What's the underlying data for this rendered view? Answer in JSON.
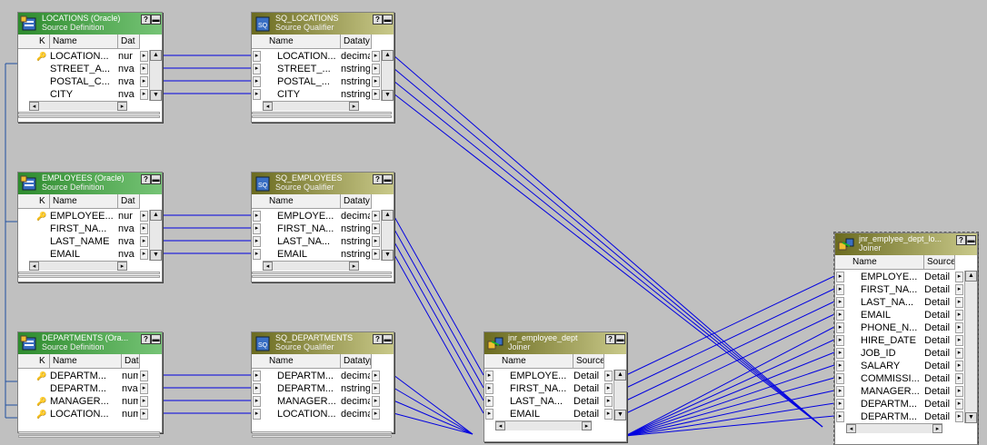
{
  "colors": {
    "link": "#0000e0",
    "source_header": "#2e8b2e",
    "qualifier_header": "#8b8b3a",
    "canvas": "#c0c0c0"
  },
  "tables": {
    "loc_src": {
      "title": "LOCATIONS (Oracle)",
      "subtitle": "Source Definition",
      "cols": [
        "K",
        "Name",
        "Dat"
      ],
      "rows": [
        {
          "key": "🔑",
          "name": "LOCATION...",
          "type": "nur"
        },
        {
          "key": "",
          "name": "STREET_A...",
          "type": "nva"
        },
        {
          "key": "",
          "name": "POSTAL_C...",
          "type": "nva"
        },
        {
          "key": "",
          "name": "CITY",
          "type": "nva"
        }
      ]
    },
    "loc_sq": {
      "title": "SQ_LOCATIONS",
      "subtitle": "Source Qualifier",
      "cols": [
        "Name",
        "Dataty"
      ],
      "rows": [
        {
          "name": "LOCATION...",
          "type": "decimal"
        },
        {
          "name": "STREET_...",
          "type": "nstring"
        },
        {
          "name": "POSTAL_...",
          "type": "nstring"
        },
        {
          "name": "CITY",
          "type": "nstring"
        }
      ]
    },
    "emp_src": {
      "title": "EMPLOYEES (Oracle)",
      "subtitle": "Source Definition",
      "cols": [
        "K",
        "Name",
        "Dat"
      ],
      "rows": [
        {
          "key": "🔑",
          "name": "EMPLOYEE...",
          "type": "nur"
        },
        {
          "key": "",
          "name": "FIRST_NA...",
          "type": "nva"
        },
        {
          "key": "",
          "name": "LAST_NAME",
          "type": "nva"
        },
        {
          "key": "",
          "name": "EMAIL",
          "type": "nva"
        }
      ]
    },
    "emp_sq": {
      "title": "SQ_EMPLOYEES",
      "subtitle": "Source Qualifier",
      "cols": [
        "Name",
        "Dataty"
      ],
      "rows": [
        {
          "name": "EMPLOYE...",
          "type": "decimal"
        },
        {
          "name": "FIRST_NA...",
          "type": "nstring"
        },
        {
          "name": "LAST_NA...",
          "type": "nstring"
        },
        {
          "name": "EMAIL",
          "type": "nstring"
        }
      ]
    },
    "dep_src": {
      "title": "DEPARTMENTS (Ora...",
      "subtitle": "Source Definition",
      "cols": [
        "K",
        "Name",
        "Datatyp"
      ],
      "rows": [
        {
          "key": "🔑",
          "name": "DEPARTM...",
          "type": "numbe"
        },
        {
          "key": "",
          "name": "DEPARTM...",
          "type": "nvarch"
        },
        {
          "key": "🔑",
          "name": "MANAGER...",
          "type": "numbe"
        },
        {
          "key": "🔑",
          "name": "LOCATION...",
          "type": "numbe"
        }
      ]
    },
    "dep_sq": {
      "title": "SQ_DEPARTMENTS",
      "subtitle": "Source Qualifier",
      "cols": [
        "Name",
        "Datatype"
      ],
      "rows": [
        {
          "name": "DEPARTM...",
          "type": "decimal"
        },
        {
          "name": "DEPARTM...",
          "type": "nstring"
        },
        {
          "name": "MANAGER...",
          "type": "decimal"
        },
        {
          "name": "LOCATION...",
          "type": "decimal"
        }
      ]
    },
    "jnr1": {
      "title": "jnr_employee_dept",
      "subtitle": "Joiner",
      "cols": [
        "Name",
        "Source"
      ],
      "rows": [
        {
          "name": "EMPLOYE...",
          "type": "Detail"
        },
        {
          "name": "FIRST_NA...",
          "type": "Detail"
        },
        {
          "name": "LAST_NA...",
          "type": "Detail"
        },
        {
          "name": "EMAIL",
          "type": "Detail"
        }
      ]
    },
    "jnr2": {
      "title": "jnr_emplyee_dept_lo...",
      "subtitle": "Joiner",
      "cols": [
        "Name",
        "Source"
      ],
      "rows": [
        {
          "name": "EMPLOYE...",
          "type": "Detail"
        },
        {
          "name": "FIRST_NA...",
          "type": "Detail"
        },
        {
          "name": "LAST_NA...",
          "type": "Detail"
        },
        {
          "name": "EMAIL",
          "type": "Detail"
        },
        {
          "name": "PHONE_N...",
          "type": "Detail"
        },
        {
          "name": "HIRE_DATE",
          "type": "Detail"
        },
        {
          "name": "JOB_ID",
          "type": "Detail"
        },
        {
          "name": "SALARY",
          "type": "Detail"
        },
        {
          "name": "COMMISSI...",
          "type": "Detail"
        },
        {
          "name": "MANAGER...",
          "type": "Detail"
        },
        {
          "name": "DEPARTM...",
          "type": "Detail"
        },
        {
          "name": "DEPARTM...",
          "type": "Detail"
        }
      ]
    }
  }
}
